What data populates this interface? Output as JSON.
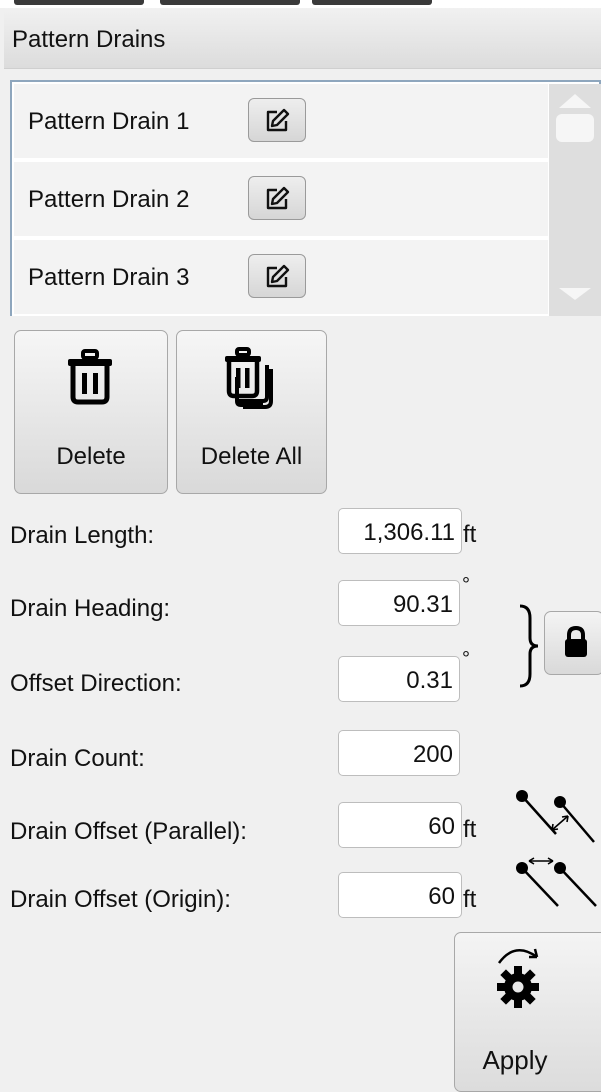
{
  "panel": {
    "title": "Pattern Drains"
  },
  "drains": [
    {
      "label": "Pattern Drain 1"
    },
    {
      "label": "Pattern Drain 2"
    },
    {
      "label": "Pattern Drain 3"
    }
  ],
  "actions": {
    "delete_label": "Delete",
    "delete_all_label": "Delete All",
    "apply_label": "Apply"
  },
  "fields": {
    "drain_length": {
      "label": "Drain Length:",
      "value": "1,306.11",
      "unit": "ft"
    },
    "drain_heading": {
      "label": "Drain Heading:",
      "value": "90.31",
      "unit": "°"
    },
    "offset_direction": {
      "label": "Offset Direction:",
      "value": "0.31",
      "unit": "°"
    },
    "drain_count": {
      "label": "Drain Count:",
      "value": "200"
    },
    "offset_parallel": {
      "label": "Drain Offset (Parallel):",
      "value": "60",
      "unit": "ft"
    },
    "offset_origin": {
      "label": "Drain Offset (Origin):",
      "value": "60",
      "unit": "ft"
    }
  },
  "icons": {
    "edit": "pencil-square-icon",
    "delete": "trash-icon",
    "delete_all": "trash-stack-icon",
    "lock": "lock-icon",
    "apply": "gear-rotate-icon",
    "scroll_up": "triangle-up-icon",
    "scroll_down": "triangle-down-icon"
  },
  "colors": {
    "list_border": "#8ea6bd",
    "button_border": "#a8a8a8",
    "text": "#111111"
  }
}
